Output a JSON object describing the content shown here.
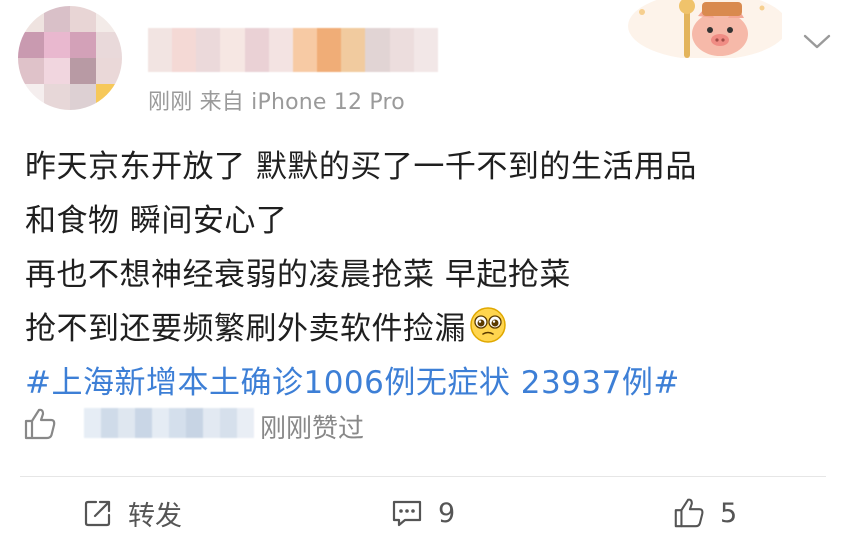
{
  "post": {
    "meta": "刚刚 来自 iPhone 12 Pro",
    "content_lines": [
      "昨天京东开放了 默默的买了一千不到的生活用品",
      "和食物 瞬间安心了",
      "再也不想神经衰弱的凌晨抢菜 早起抢菜",
      "抢不到还要频繁刷外卖软件捡漏"
    ],
    "topic": "#上海新增本土确诊1006例无症状 23937例#"
  },
  "liked": {
    "text": "刚刚赞过"
  },
  "actions": {
    "repost_label": "转发",
    "comment_count": "9",
    "like_count": "5"
  },
  "colors": {
    "topic": "#3d7fd6",
    "meta": "#9a9a9a",
    "action": "#555555"
  }
}
